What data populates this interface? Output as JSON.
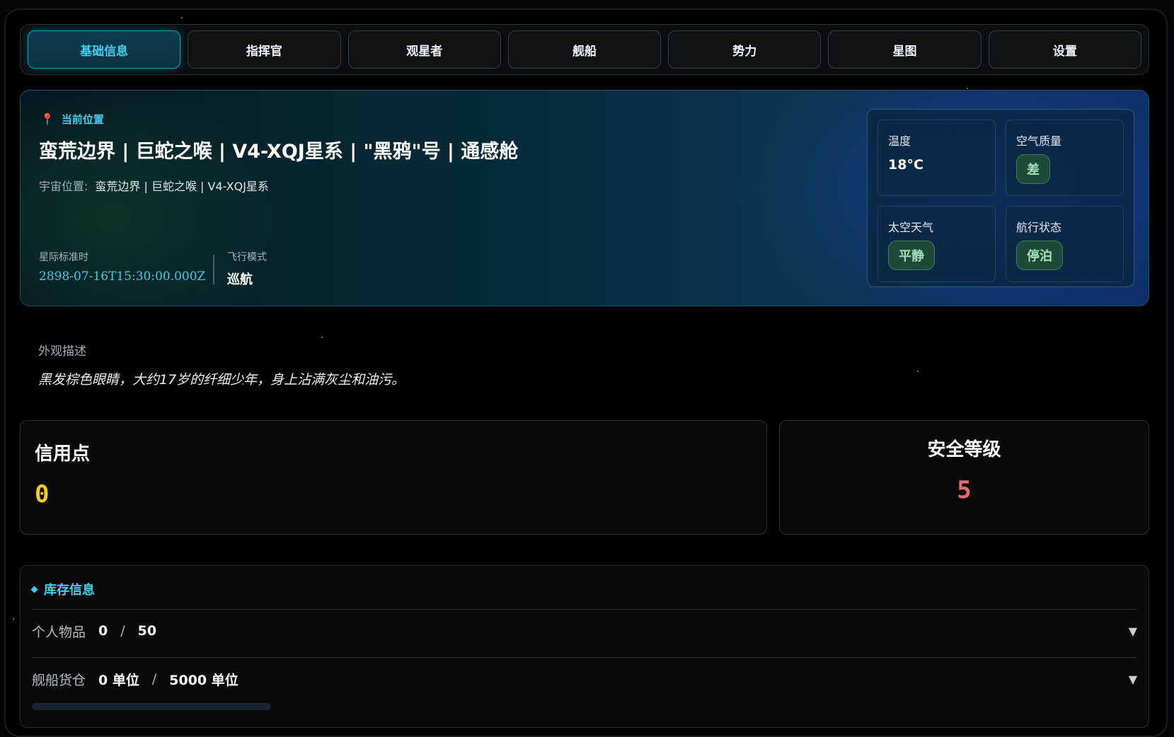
{
  "tabs": [
    {
      "label": "基础信息",
      "active": true
    },
    {
      "label": "指挥官",
      "active": false
    },
    {
      "label": "观星者",
      "active": false
    },
    {
      "label": "舰船",
      "active": false
    },
    {
      "label": "势力",
      "active": false
    },
    {
      "label": "星图",
      "active": false
    },
    {
      "label": "设置",
      "active": false
    }
  ],
  "location": {
    "icon": "map-pin-icon",
    "label": "当前位置",
    "title": "蛮荒边界 | 巨蛇之喉 | V4-XQJ星系 | \"黑鸦\"号 | 通感舱",
    "sub_label": "宇宙位置:",
    "sub_value": "蛮荒边界 | 巨蛇之喉 | V4-XQJ星系",
    "time_label": "星际标准时",
    "time_value": "2898-07-16T15:30:00.000Z",
    "mode_label": "飞行模式",
    "mode_value": "巡航"
  },
  "environment": {
    "temperature_label": "温度",
    "temperature_value": "18°C",
    "air_label": "空气质量",
    "air_value": "差",
    "weather_label": "太空天气",
    "weather_value": "平静",
    "nav_label": "航行状态",
    "nav_value": "停泊"
  },
  "appearance": {
    "label": "外观描述",
    "text": "黑发棕色眼睛，大约17岁的纤细少年，身上沾满灰尘和油污。"
  },
  "credits": {
    "label": "信用点",
    "value": "0"
  },
  "security": {
    "label": "安全等级",
    "value": "5"
  },
  "inventory": {
    "title": "库存信息",
    "personal_label": "个人物品",
    "personal_used": "0",
    "personal_sep": "/",
    "personal_cap": "50",
    "cargo_label": "舰船货仓",
    "cargo_used": "0 单位",
    "cargo_sep": "/",
    "cargo_cap": "5000 单位",
    "cargo_fill_fraction": 0,
    "expand_icon": "triangle-down-icon"
  },
  "colors": {
    "accent": "#3fd0f0",
    "credits": "#f7cc15",
    "security": "#e86a70",
    "pill_green": "#9fe0b5"
  }
}
